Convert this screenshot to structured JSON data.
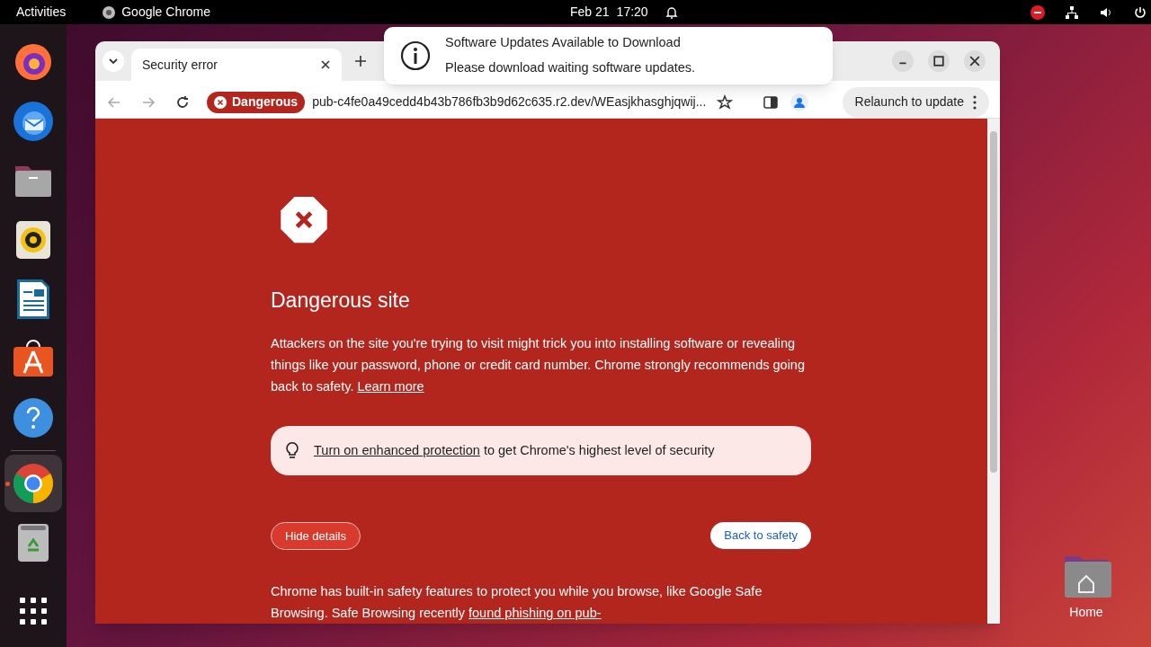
{
  "top_bar": {
    "activities": "Activities",
    "app": "Google Chrome",
    "date": "Feb 21",
    "time": "17:20"
  },
  "dock": {
    "items": [
      {
        "kind": "firefox",
        "running": false
      },
      {
        "kind": "thunderbird",
        "running": false
      },
      {
        "kind": "files",
        "running": false
      },
      {
        "kind": "rhythmbox",
        "running": false
      },
      {
        "kind": "writer",
        "running": false
      },
      {
        "kind": "appcenter",
        "running": false
      },
      {
        "kind": "help",
        "running": false
      },
      {
        "kind": "chrome",
        "running": true
      },
      {
        "kind": "trash",
        "running": false
      }
    ]
  },
  "notification": {
    "title": "Software Updates Available to Download",
    "body": "Please download waiting software updates."
  },
  "browser": {
    "tab": {
      "title": "Security error",
      "selected": true
    },
    "security_chip": "Dangerous",
    "url": "pub-c4fe0a49cedd4b43b786fb3b9d62c635.r2.dev/WEasjkhasghjqwij...",
    "relaunch": "Relaunch to update"
  },
  "page": {
    "heading": "Dangerous site",
    "paragraph": "Attackers on the site you're trying to visit might trick you into installing software or revealing things like your password, phone or credit card number. Chrome strongly recommends going back to safety.",
    "learn_more": "Learn more",
    "protection_link": "Turn on enhanced protection",
    "protection_text": "to get Chrome's highest level of security",
    "hide_details": "Hide details",
    "back_to_safety": "Back to safety",
    "details_text": "Chrome has built-in safety features to protect you while you browse, like Google Safe Browsing. Safe Browsing recently",
    "details_link": "found phishing on pub-"
  },
  "desktop": {
    "home_label": "Home"
  }
}
